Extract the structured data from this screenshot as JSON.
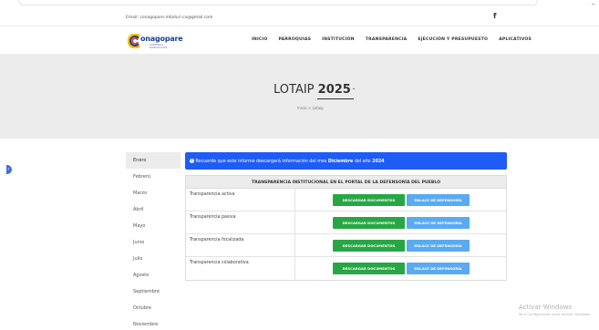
{
  "topbar": {
    "email": "Email: conagopare.mbiduri.co@gmail.com",
    "facebook_glyph": "f",
    "window_min": "–"
  },
  "nav": {
    "logo_text": "onagopare",
    "logo_sub": "GOBIERNOS PARROQUIALES",
    "items": [
      "INICIO",
      "PARROQUIAS",
      "INSTITUCIÓN",
      "TRANSPARENCIA",
      "EJECUCIÓN Y PRESUPUESTO",
      "APLICATIVOS"
    ]
  },
  "hero": {
    "title_prefix": "LOTAIP",
    "year": "2025",
    "chevron": "⌄",
    "breadcrumb": "Inicio  >  Lotaip"
  },
  "months": [
    "Enero",
    "Febrero",
    "Marzo",
    "Abril",
    "Mayo",
    "Junio",
    "Julio",
    "Agosto",
    "Septiembre",
    "Octubre",
    "Noviembre"
  ],
  "active_month": "Enero",
  "alert": {
    "icon": "!",
    "text": "Recuerde que este informe descargará información del mes ",
    "month": "Diciembre",
    "mid": " del año ",
    "year": "2024"
  },
  "table": {
    "header": "TRANSPARENCIA INSTITUCIONAL EN EL PORTAL DE LA DEFENSORÍA DEL PUEBLO",
    "rows": [
      {
        "label": "Transparencia activa",
        "download": "DESCARGAR DOCUMENTOS",
        "link": "ENLACE DE DEFENSORÍA"
      },
      {
        "label": "Transparencia pasiva",
        "download": "DESCARGAR DOCUMENTOS",
        "link": "ENLACE DE DEFENSORÍA"
      },
      {
        "label": "Transparencia focalizada",
        "download": "DESCARGAR DOCUMENTOS",
        "link": "ENLACE DE DEFENSORÍA"
      },
      {
        "label": "Transparencia colaborativa",
        "download": "DESCARGAR DOCUMENTOS",
        "link": "ENLACE DE DEFENSORÍA"
      }
    ]
  },
  "watermark": {
    "title": "Activar Windows",
    "subtitle": "Ve a Configuración para activar Windows."
  },
  "colors": {
    "alert": "#1f5cf5",
    "download_button": "#27a744",
    "link_button": "#5aaaf2",
    "hero_bg": "#ececec"
  }
}
